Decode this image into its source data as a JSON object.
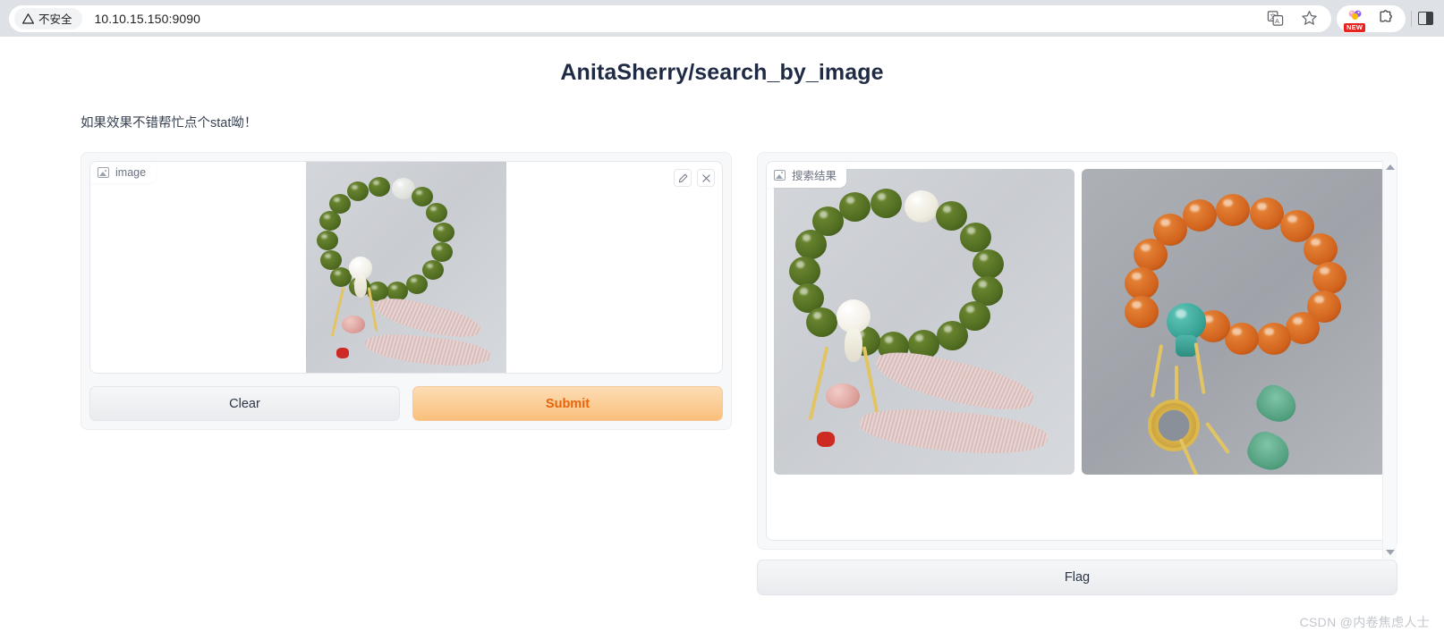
{
  "browser": {
    "security_label": "不安全",
    "url": "10.10.15.150:9090",
    "icons": {
      "translate": "translate-icon",
      "bookmark": "star-icon",
      "new_extension": "extension-promo-icon",
      "new_badge": "NEW",
      "extensions": "puzzle-icon",
      "side_panel": "side-panel-icon"
    }
  },
  "app": {
    "title": "AnitaSherry/search_by_image",
    "subtitle": "如果效果不错帮忙点个stat呦！"
  },
  "input_panel": {
    "label": "image",
    "edit_tooltip": "edit-icon",
    "clear_tooltip": "close-icon",
    "clear_button": "Clear",
    "submit_button": "Submit",
    "image_alt": "green jade bead bracelet with white beads and pink tassel"
  },
  "results_panel": {
    "label": "搜索结果",
    "flag_button": "Flag",
    "items": [
      {
        "alt": "green jade bead bracelet with white guru bead and pink tassel"
      },
      {
        "alt": "orange amber bead bracelet with turquoise guru bead and jade pendants"
      }
    ],
    "scrollbar": {
      "up": "scroll-up-arrow",
      "down": "scroll-down-arrow"
    }
  },
  "watermark": "CSDN @内卷焦虑人士",
  "colors": {
    "accent_orange": "#e8640a",
    "title_navy": "#1f2a44",
    "chrome_gray": "#dee1e6"
  }
}
